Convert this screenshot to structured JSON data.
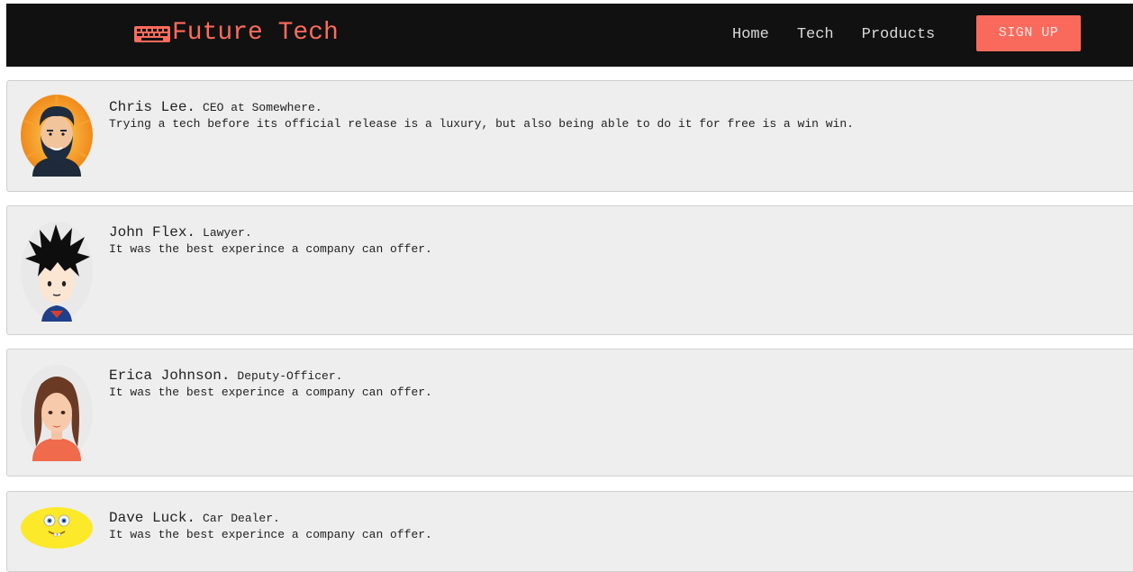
{
  "header": {
    "brand": "Future Tech",
    "nav": [
      "Home",
      "Tech",
      "Products"
    ],
    "signup_label": "SIGN UP"
  },
  "testimonials": [
    {
      "name": "Chris Lee.",
      "role": "CEO at Somewhere.",
      "quote": "Trying a tech before its official release is a luxury, but also being able to do it for free is a win win."
    },
    {
      "name": "John Flex.",
      "role": "Lawyer.",
      "quote": "It was the best experince a company can offer."
    },
    {
      "name": "Erica Johnson.",
      "role": "Deputy-Officer.",
      "quote": "It was the best experince a company can offer."
    },
    {
      "name": "Dave Luck.",
      "role": "Car Dealer.",
      "quote": "It was the best experince a company can offer."
    }
  ],
  "colors": {
    "navbar_bg": "#111111",
    "brand": "#fd6b5c",
    "signup_bg": "#f96a5c",
    "card_bg": "#eeeeee"
  },
  "icons": [
    "keyboard-icon",
    "bearded-man-avatar",
    "spiky-hair-boy-avatar",
    "brunette-woman-avatar",
    "sponge-face-avatar"
  ]
}
